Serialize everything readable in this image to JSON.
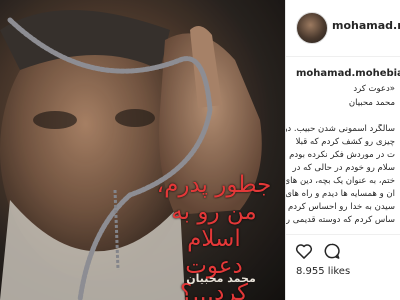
{
  "post": {
    "poster_caption": [
      "جطور پدرم،",
      "من رو به اسلام",
      "دعوت کرد...؟"
    ],
    "poster_signature": "محمد محبیان"
  },
  "header": {
    "username": "mohamad.mohebian"
  },
  "caption": {
    "username": "mohamad.mohebian",
    "title_line1": "«دعوت کرد",
    "title_line2": "محمد محبیان",
    "lines": [
      "سالگرد آسمونی شدن حبیب. در",
      "چیزی رو کشف کردم که قبلا",
      "ت در موردش فکر نکرده بودم",
      "سلام رو خودم در حالی که در",
      "ختم، به عنوان یک بچه، دین های",
      "ان و همسایه ها دیدم و راه های",
      "سیدن به خدا رو احساس کردم",
      "ساس کردم که دوسته قدیمی رو"
    ]
  },
  "actions": {
    "like_icon": "heart-outline-icon",
    "comment_icon": "speech-bubble-icon"
  },
  "likes_text": "8.955 likes"
}
